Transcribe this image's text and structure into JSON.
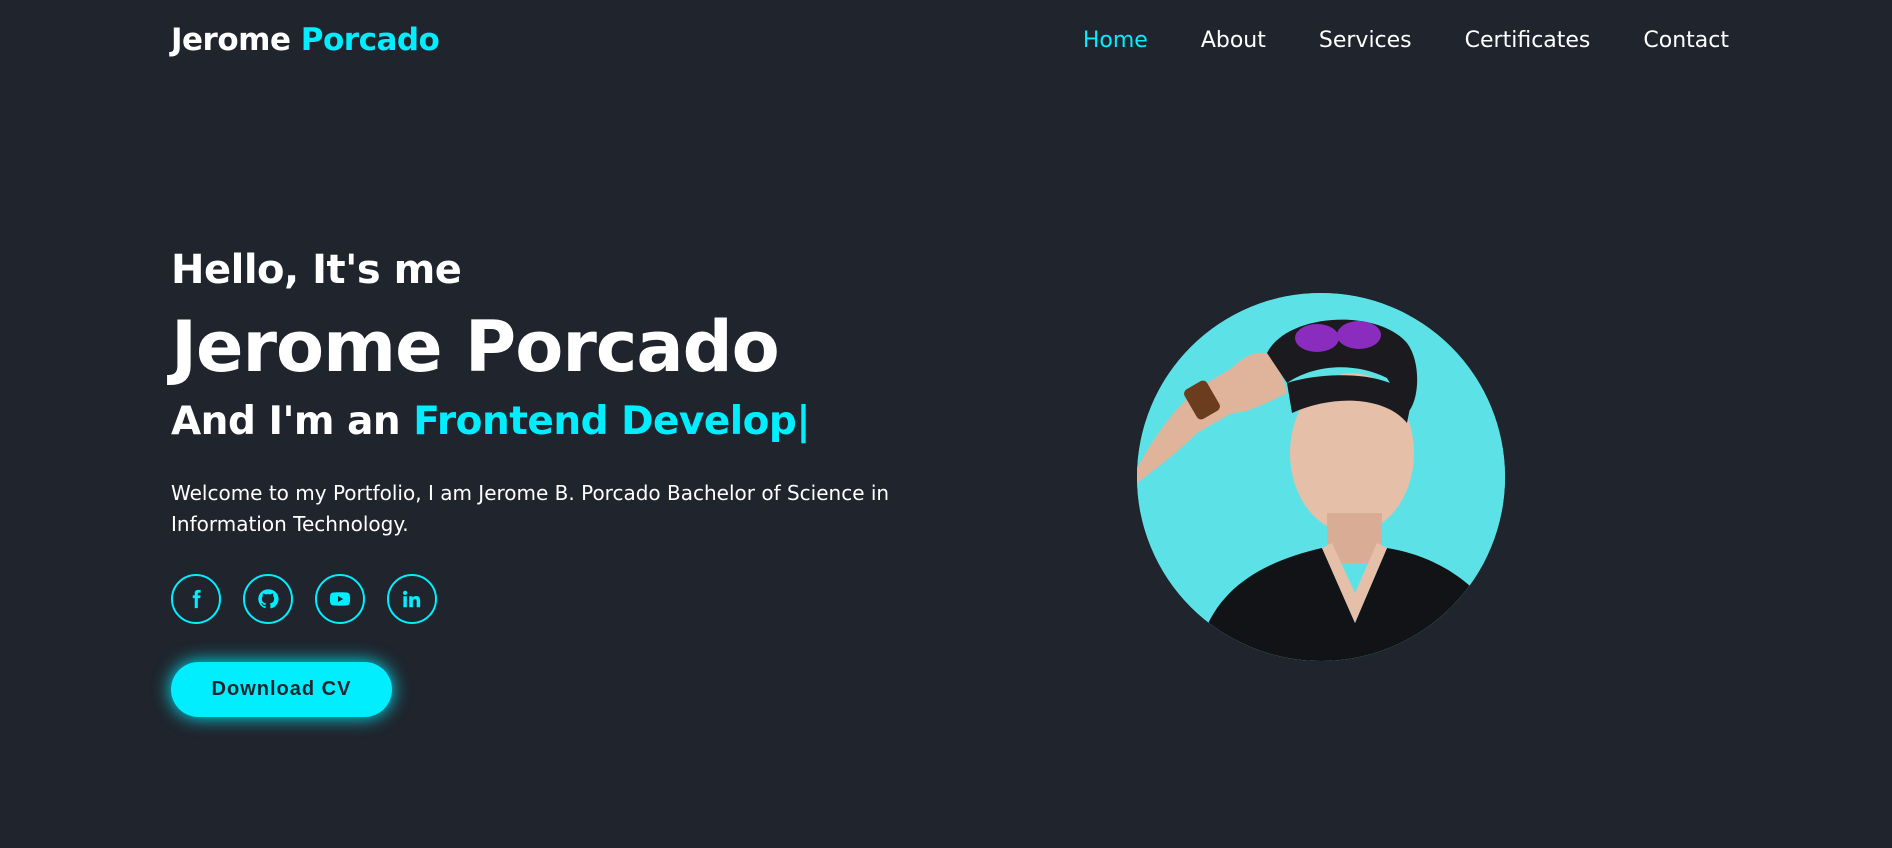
{
  "header": {
    "logo_first": "Jerome ",
    "logo_accent": "Porcado"
  },
  "nav": {
    "items": [
      {
        "label": "Home",
        "active": true
      },
      {
        "label": "About",
        "active": false
      },
      {
        "label": "Services",
        "active": false
      },
      {
        "label": "Certificates",
        "active": false
      },
      {
        "label": "Contact",
        "active": false
      }
    ]
  },
  "hero": {
    "greeting": "Hello, It's me",
    "name": "Jerome Porcado",
    "role_prefix": "And I'm an ",
    "role_typed": "Frontend Develop",
    "caret": "|",
    "intro": "Welcome to my Portfolio, I am Jerome B. Porcado Bachelor of Science in Information Technology."
  },
  "social": [
    {
      "icon": "facebook-icon"
    },
    {
      "icon": "github-icon"
    },
    {
      "icon": "youtube-icon"
    },
    {
      "icon": "linkedin-icon"
    }
  ],
  "cta": {
    "download_label": "Download CV"
  },
  "colors": {
    "background": "#1f242d",
    "accent": "#00eeff",
    "text": "#ffffff",
    "avatar_bg": "#5ce1e6"
  }
}
